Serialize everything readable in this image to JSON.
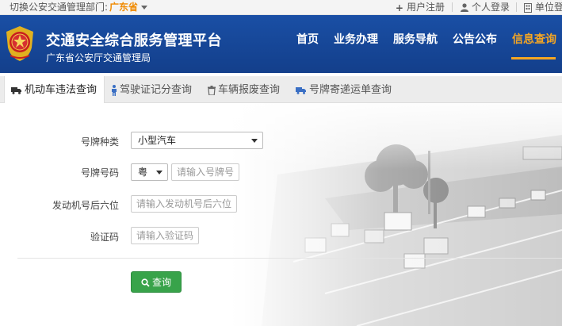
{
  "topbar": {
    "switch_label": "切换公安交通管理部门:",
    "province": "广东省",
    "register": "用户注册",
    "personal_login": "个人登录",
    "unit_login": "单位登"
  },
  "header": {
    "title": "交通安全综合服务管理平台",
    "subtitle": "广东省公安厅交通管理局",
    "nav": [
      "首页",
      "业务办理",
      "服务导航",
      "公告公布",
      "信息查询"
    ],
    "active_nav": "信息查询"
  },
  "tabs": [
    {
      "label": "机动车违法查询",
      "icon": "truck-icon",
      "active": true
    },
    {
      "label": "驾驶证记分查询",
      "icon": "person-icon",
      "active": false
    },
    {
      "label": "车辆报废查询",
      "icon": "trash-icon",
      "active": false
    },
    {
      "label": "号牌寄递运单查询",
      "icon": "truck-icon",
      "active": false
    }
  ],
  "form": {
    "plate_type_label": "号牌种类",
    "plate_type_value": "小型汽车",
    "plate_no_label": "号牌号码",
    "plate_prefix": "粤",
    "plate_no_placeholder": "请输入号牌号",
    "engine_label": "发动机号后六位",
    "engine_placeholder": "请输入发动机号后六位",
    "captcha_label": "验证码",
    "captcha_placeholder": "请输入验证码",
    "query_button": "查询"
  },
  "colors": {
    "header_bg": "#1a4fa5",
    "active_nav": "#f5a623",
    "province": "#f08a00",
    "query_button": "#38a34a"
  }
}
